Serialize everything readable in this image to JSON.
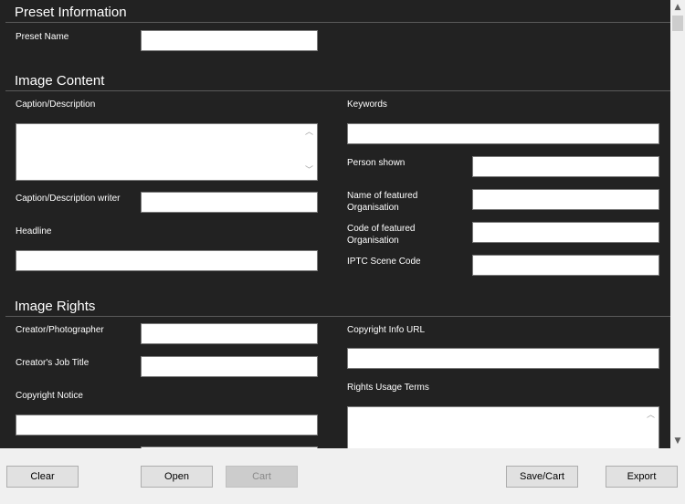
{
  "sections": {
    "preset": {
      "title": "Preset Information",
      "preset_name_label": "Preset Name",
      "preset_name_value": ""
    },
    "content": {
      "title": "Image Content",
      "caption_label": "Caption/Description",
      "caption_value": "",
      "caption_writer_label": "Caption/Description writer",
      "caption_writer_value": "",
      "headline_label": "Headline",
      "headline_value": "",
      "keywords_label": "Keywords",
      "keywords_value": "",
      "person_shown_label": "Person shown",
      "person_shown_value": "",
      "org_name_label_1": "Name of featured",
      "org_name_label_2": "Organisation",
      "org_name_value": "",
      "org_code_label_1": "Code of featured",
      "org_code_label_2": "Organisation",
      "org_code_value": "",
      "scene_code_label": "IPTC Scene Code",
      "scene_code_value": ""
    },
    "rights": {
      "title": "Image Rights",
      "creator_label": "Creator/Photographer",
      "creator_value": "",
      "job_title_label": "Creator's Job Title",
      "job_title_value": "",
      "copyright_notice_label": "Copyright Notice",
      "copyright_notice_value": "",
      "copyright_url_label": "Copyright Info URL",
      "copyright_url_value": "",
      "usage_terms_label": "Rights Usage Terms",
      "usage_terms_value": ""
    }
  },
  "buttons": {
    "clear": "Clear",
    "open": "Open",
    "cart": "Cart",
    "save_cart": "Save/Cart",
    "export": "Export"
  },
  "colors": {
    "form_background": "#222222",
    "button_bar": "#f0f0f0",
    "disabled_button": "#cccccc"
  }
}
